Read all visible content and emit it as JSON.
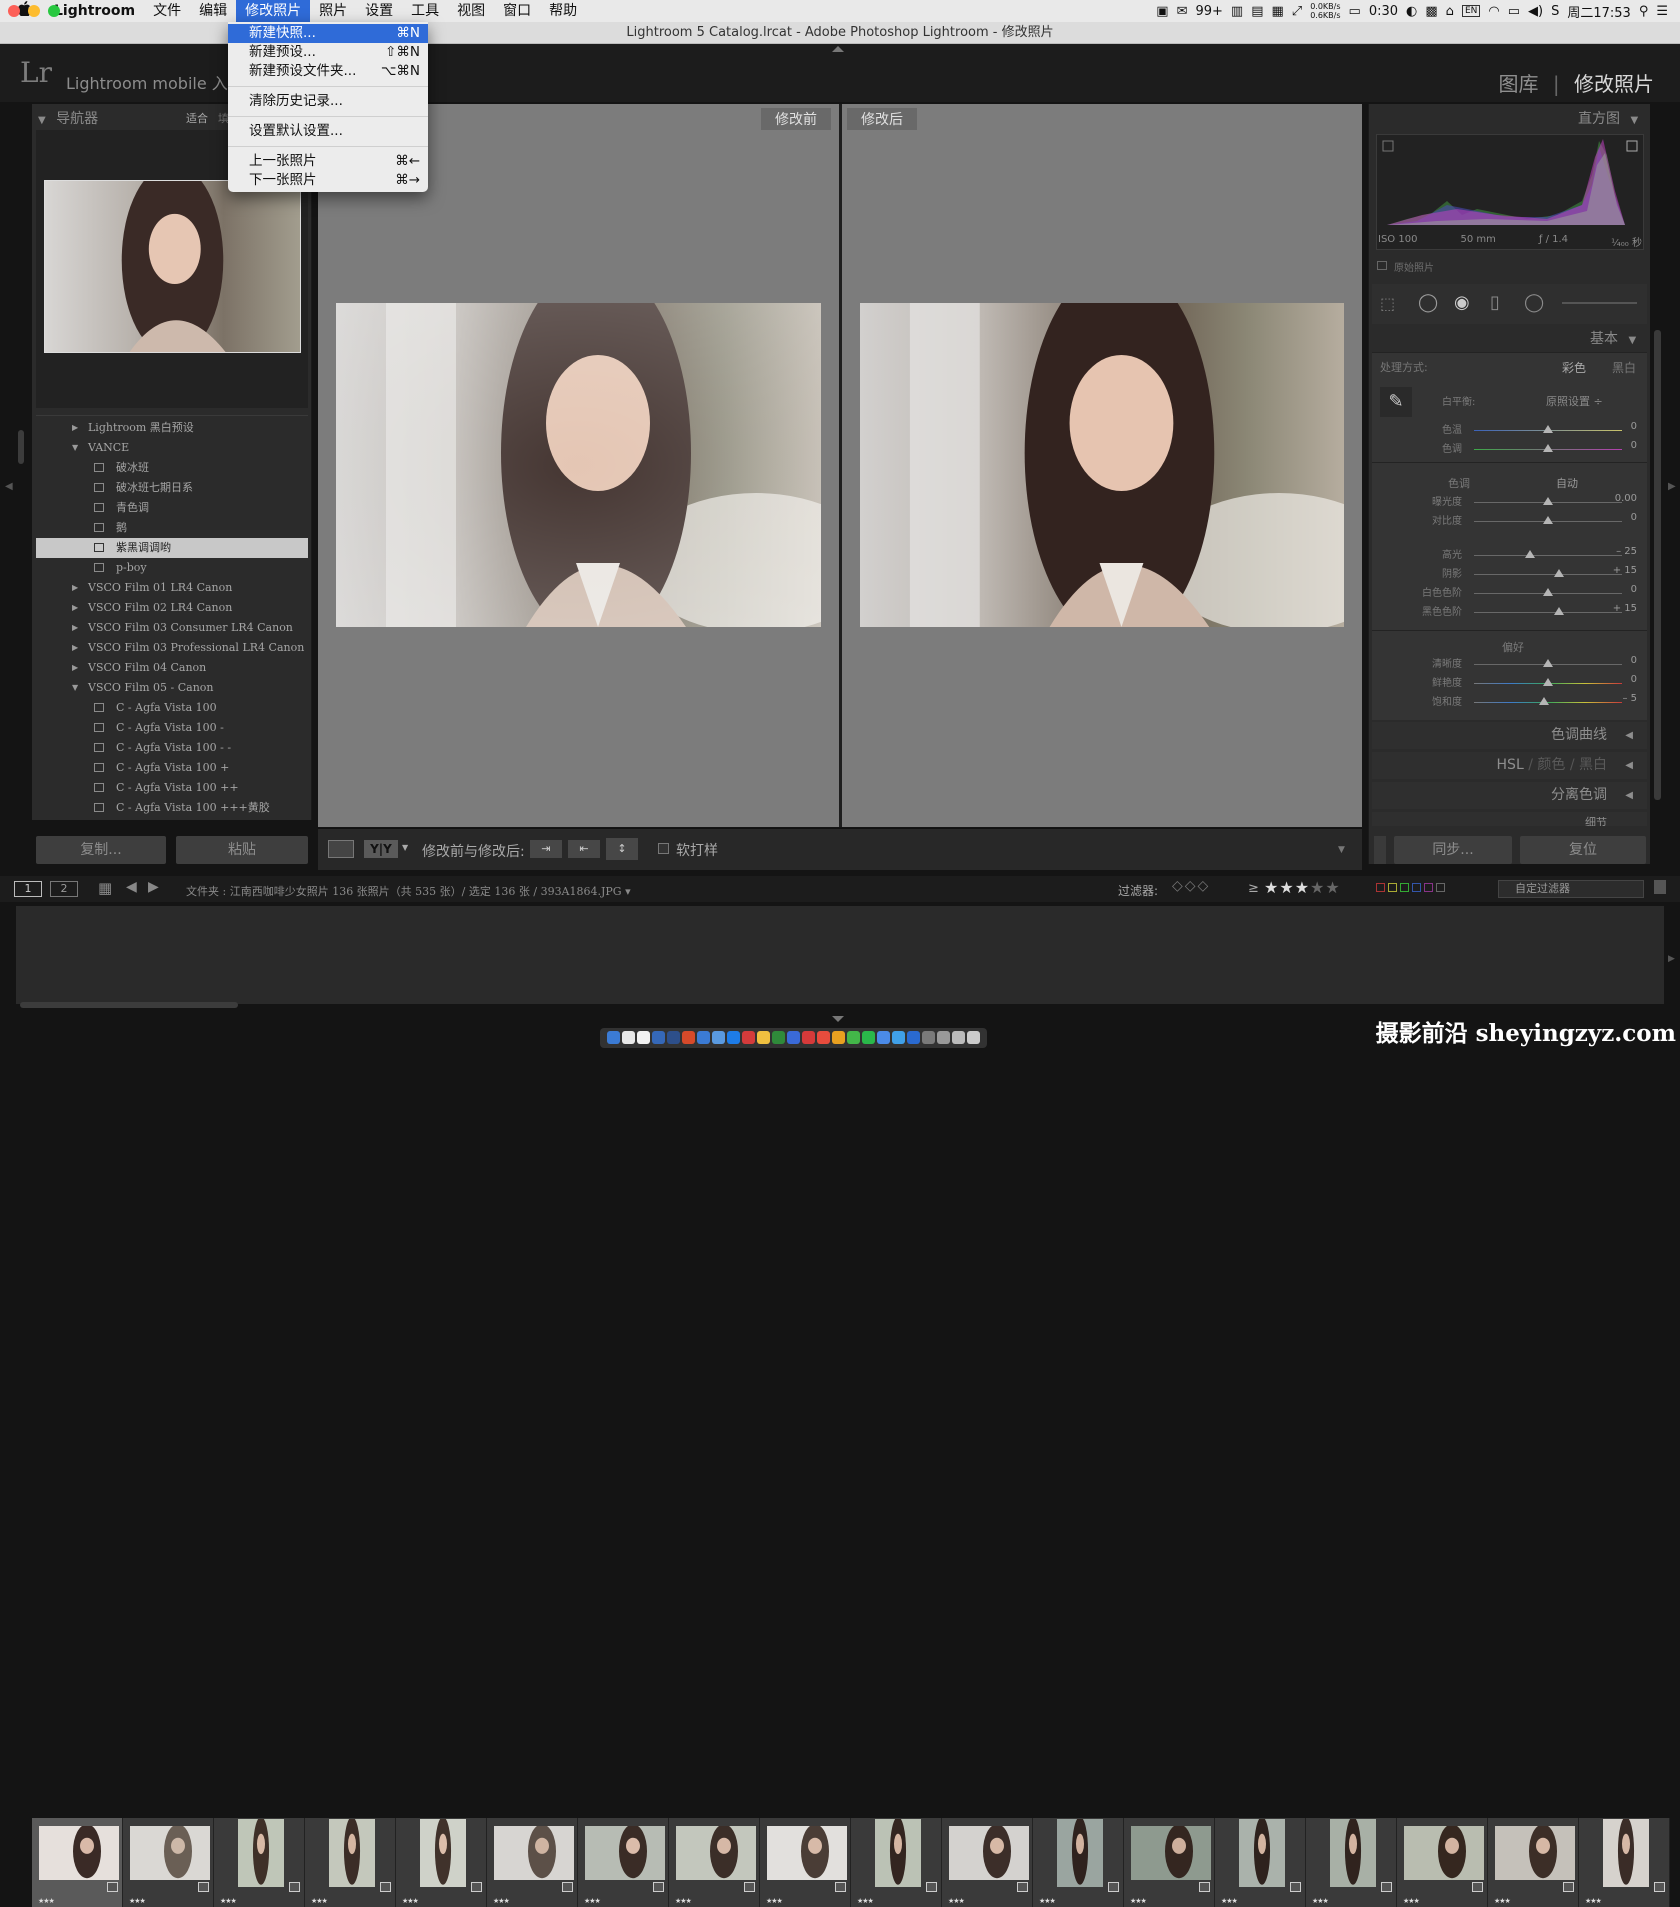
{
  "menubar": {
    "apple": "",
    "app_name": "Lightroom",
    "items": [
      "文件",
      "编辑",
      "修改照片",
      "照片",
      "设置",
      "工具",
      "视图",
      "窗口",
      "帮助"
    ],
    "active_index": 2,
    "status": {
      "badge": "99+",
      "net_up": "0.0KB/s",
      "net_down": "0.6KB/s",
      "battery_time": "0:30",
      "input": "EN",
      "clock": "周二17:53"
    }
  },
  "window": {
    "title": "Lightroom 5 Catalog.lrcat - Adobe Photoshop Lightroom - 修改照片"
  },
  "dropdown": {
    "items": [
      {
        "label": "新建快照...",
        "shortcut": "⌘N",
        "highlighted": true
      },
      {
        "label": "新建预设...",
        "shortcut": "⇧⌘N"
      },
      {
        "label": "新建预设文件夹...",
        "shortcut": "⌥⌘N"
      },
      {
        "sep": true
      },
      {
        "label": "清除历史记录...",
        "shortcut": ""
      },
      {
        "sep": true
      },
      {
        "label": "设置默认设置...",
        "shortcut": ""
      },
      {
        "sep": true
      },
      {
        "label": "上一张照片",
        "shortcut": "⌘←"
      },
      {
        "label": "下一张照片",
        "shortcut": "⌘→"
      }
    ]
  },
  "identity": {
    "logo": "Lr",
    "plate": "Lightroom mobile 入门",
    "module_library": "图库",
    "module_divider": "|",
    "module_develop": "修改照片"
  },
  "navigator": {
    "title": "导航器",
    "fit": "适合",
    "fill": "填"
  },
  "presets": [
    {
      "label": "Lightroom 黑白预设",
      "type": "folder",
      "open": false
    },
    {
      "label": "VANCE",
      "type": "folder",
      "open": true
    },
    {
      "label": "破冰班",
      "type": "item"
    },
    {
      "label": "破冰班七期日系",
      "type": "item"
    },
    {
      "label": "青色调",
      "type": "item"
    },
    {
      "label": "鹅",
      "type": "item"
    },
    {
      "label": "紫黑调调哟",
      "type": "item",
      "selected": true
    },
    {
      "label": "p-boy",
      "type": "item"
    },
    {
      "label": "VSCO Film 01 LR4 Canon",
      "type": "folder",
      "open": false
    },
    {
      "label": "VSCO Film 02 LR4 Canon",
      "type": "folder",
      "open": false
    },
    {
      "label": "VSCO Film 03 Consumer LR4 Canon",
      "type": "folder",
      "open": false
    },
    {
      "label": "VSCO Film 03 Professional LR4 Canon",
      "type": "folder",
      "open": false
    },
    {
      "label": "VSCO Film 04 Canon",
      "type": "folder",
      "open": false
    },
    {
      "label": "VSCO Film 05 - Canon",
      "type": "folder",
      "open": true
    },
    {
      "label": "C - Agfa Vista 100",
      "type": "item"
    },
    {
      "label": "C - Agfa Vista 100 -",
      "type": "item"
    },
    {
      "label": "C - Agfa Vista 100 - -",
      "type": "item"
    },
    {
      "label": "C - Agfa Vista 100 +",
      "type": "item"
    },
    {
      "label": "C - Agfa Vista 100 ++",
      "type": "item"
    },
    {
      "label": "C - Agfa Vista 100 +++黄胶",
      "type": "item"
    }
  ],
  "left_buttons": {
    "copy": "复制...",
    "paste": "粘贴"
  },
  "compare": {
    "before": "修改前",
    "after": "修改后"
  },
  "toolbar": {
    "yy": "Y|Y",
    "mode_label": "修改前与修改后:",
    "softproof": "软打样"
  },
  "histogram": {
    "title": "直方图",
    "iso": "ISO 100",
    "focal": "50 mm",
    "aperture": "ƒ / 1.4",
    "shutter": "¹⁄₄₀₀ 秒",
    "original": "原始照片"
  },
  "basic": {
    "title": "基本",
    "treatment_label": "处理方式:",
    "color": "彩色",
    "bw": "黑白",
    "wb_label": "白平衡:",
    "wb_value": "原照设置 ÷",
    "tone_label": "色调",
    "auto": "自动",
    "presence_label": "偏好",
    "sliders_wb": [
      {
        "label": "色温",
        "value": "0",
        "pos": 0.5
      },
      {
        "label": "色调",
        "value": "0",
        "pos": 0.5
      }
    ],
    "sliders_tone1": [
      {
        "label": "曝光度",
        "value": "0.00",
        "pos": 0.5
      },
      {
        "label": "对比度",
        "value": "0",
        "pos": 0.5
      }
    ],
    "sliders_tone2": [
      {
        "label": "高光",
        "value": "– 25",
        "pos": 0.375
      },
      {
        "label": "阴影",
        "value": "+ 15",
        "pos": 0.575
      },
      {
        "label": "白色色阶",
        "value": "0",
        "pos": 0.5
      },
      {
        "label": "黑色色阶",
        "value": "+ 15",
        "pos": 0.575
      }
    ],
    "sliders_presence": [
      {
        "label": "清晰度",
        "value": "0",
        "pos": 0.5
      },
      {
        "label": "鲜艳度",
        "value": "0",
        "pos": 0.5
      },
      {
        "label": "饱和度",
        "value": "– 5",
        "pos": 0.475
      }
    ]
  },
  "collapsed_panels": {
    "tone_curve": "色调曲线",
    "hsl": "HSL",
    "hsl_color": "颜色",
    "hsl_bw": "黑白",
    "split": "分离色调",
    "detail": "细节"
  },
  "right_buttons": {
    "sync": "同步...",
    "reset": "复位"
  },
  "filmstrip_bar": {
    "screen1": "1",
    "screen2": "2",
    "path": "文件夹 : 江南西咖啡少女照片   136 张照片（共 535 张）/ 选定 136 张 / 393A1864.JPG ▾",
    "filter_label": "过滤器:",
    "rating_op": "≥",
    "filter_preset": "自定过滤器"
  },
  "filmstrip": {
    "count": 18,
    "stars": "★★★"
  },
  "watermark": "摄影前沿 sheyingzyz.com",
  "colors": {
    "menu_highlight": "#2f6bd8",
    "panel_bg": "#2b2b2b",
    "center_bg": "#7c7c7c"
  }
}
